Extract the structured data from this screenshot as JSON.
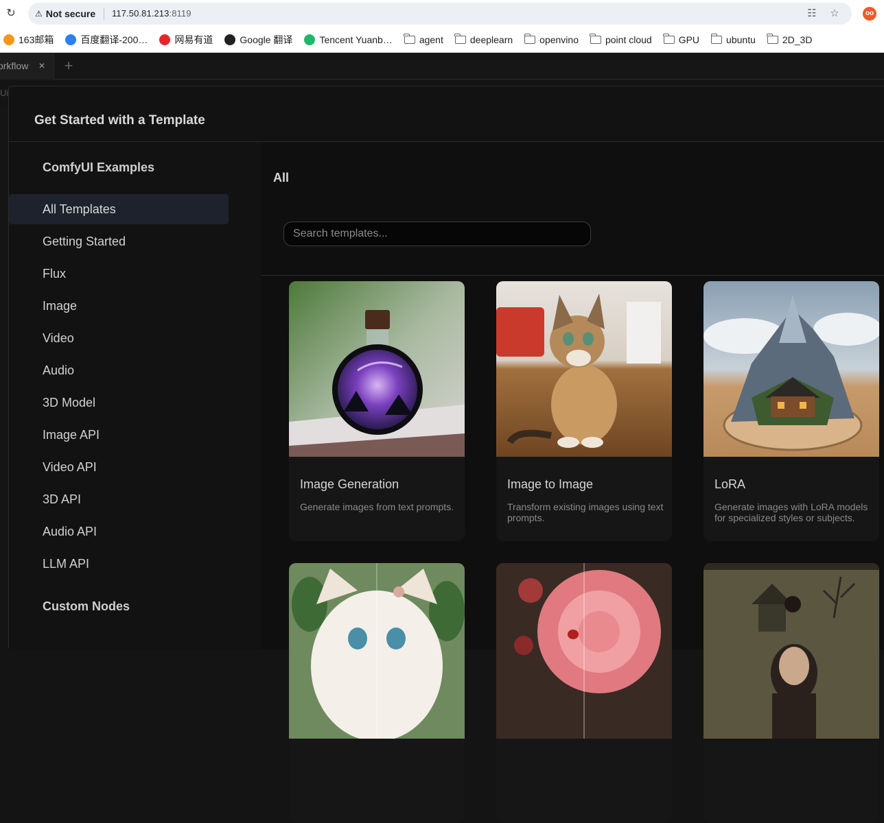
{
  "browser": {
    "security_label": "Not secure",
    "url_host": "117.50.81.213",
    "url_port": ":8119",
    "bookmarks": [
      {
        "label": "163邮箱",
        "icon": "mail-163-icon",
        "color": "#f7961d"
      },
      {
        "label": "百度翻译-200…",
        "icon": "baidu-translate-icon",
        "color": "#2b7ff0"
      },
      {
        "label": "网易有道",
        "icon": "youdao-icon",
        "color": "#e2262b"
      },
      {
        "label": "Google 翻译",
        "icon": "globe-icon",
        "color": "#202124"
      },
      {
        "label": "Tencent Yuanb…",
        "icon": "yuanbao-icon",
        "color": "#1fb86b"
      },
      {
        "label": "agent",
        "icon": "folder-icon"
      },
      {
        "label": "deeplearn",
        "icon": "folder-icon"
      },
      {
        "label": "openvino",
        "icon": "folder-icon"
      },
      {
        "label": "point cloud",
        "icon": "folder-icon"
      },
      {
        "label": "GPU",
        "icon": "folder-icon"
      },
      {
        "label": "ubuntu",
        "icon": "folder-icon"
      },
      {
        "label": "2D_3D",
        "icon": "folder-icon"
      }
    ]
  },
  "app": {
    "workflow_tab": "Workflow",
    "second_bar_text": "Ui"
  },
  "dialog": {
    "title": "Get Started with a Template",
    "sidebar": {
      "heading": "ComfyUI Examples",
      "items": [
        "All Templates",
        "Getting Started",
        "Flux",
        "Image",
        "Video",
        "Audio",
        "3D Model",
        "Image API",
        "Video API",
        "3D API",
        "Audio API",
        "LLM API"
      ],
      "active_item": "All Templates",
      "heading2": "Custom Nodes"
    },
    "content": {
      "heading": "All",
      "search_placeholder": "Search templates...",
      "cards": [
        {
          "title": "Image Generation",
          "desc": "Generate images from text prompts."
        },
        {
          "title": "Image to Image",
          "desc": "Transform existing images using text prompts."
        },
        {
          "title": "LoRA",
          "desc": "Generate images with LoRA models for specialized styles or subjects."
        }
      ]
    }
  },
  "colors": {
    "active_item_bg": "#1d222c",
    "dialog_bg": "#121212"
  }
}
